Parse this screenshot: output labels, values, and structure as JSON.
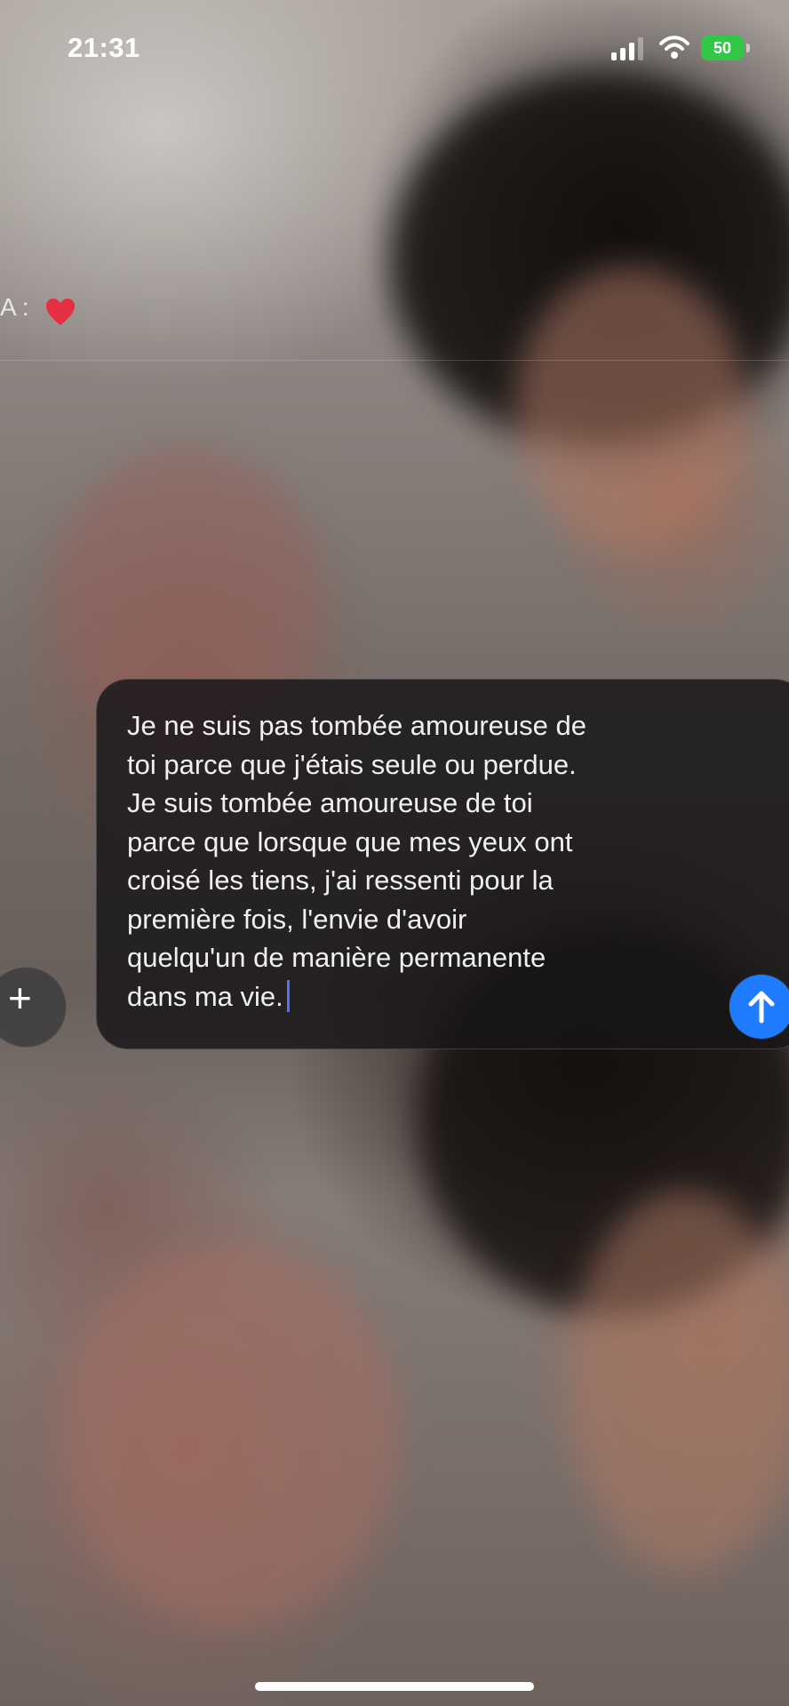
{
  "status_bar": {
    "time": "21:31",
    "battery_percent": "50",
    "battery_charging": true,
    "signal_icon": "cellular-signal-icon",
    "wifi_icon": "wifi-icon",
    "battery_icon": "battery-icon"
  },
  "conversation": {
    "reply_preview": "A :",
    "reply_icon": "heart-icon"
  },
  "composer": {
    "message_text": "Je ne suis pas tombée amoureuse de\ntoi parce que j'étais seule ou perdue.\nJe suis tombée amoureuse de toi\nparce que lorsque que mes yeux ont\ncroisé les tiens, j'ai ressenti pour la\npremière fois, l'envie d'avoir\nquelqu'un de manière permanente\ndans ma vie.",
    "plus_icon": "plus-icon",
    "send_icon": "arrow-up-icon"
  },
  "colors": {
    "accent": "#1f7cff",
    "battery": "#33c747",
    "heart": "#e52f42",
    "cursor": "#4c75ff"
  }
}
